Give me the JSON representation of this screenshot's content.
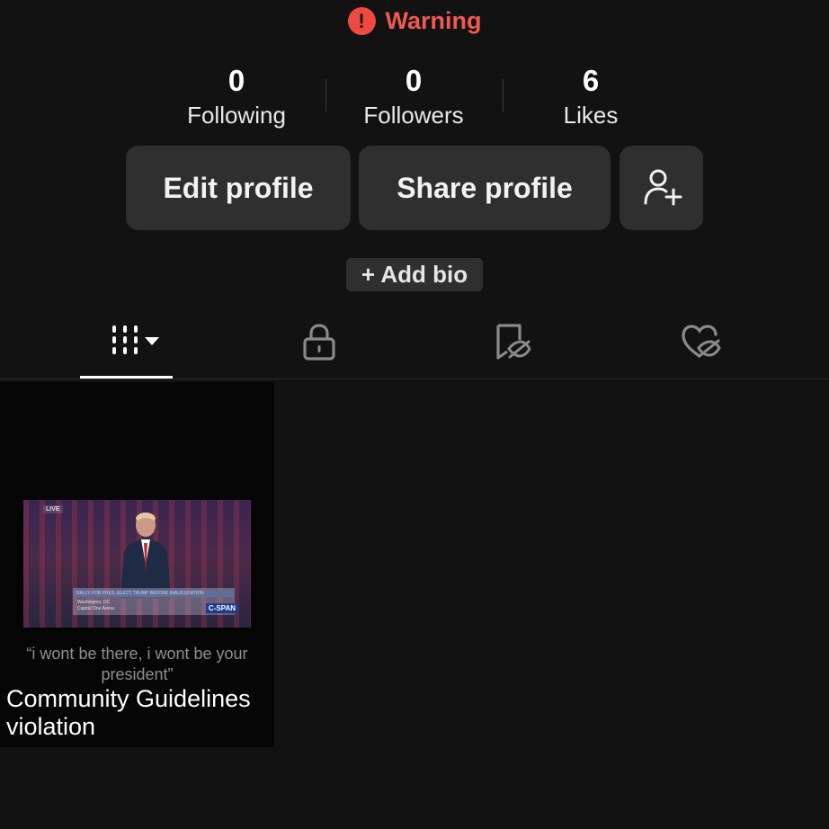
{
  "warning": {
    "icon": "exclamation-circle-icon",
    "label": "Warning",
    "color": "#ee4a43"
  },
  "stats": [
    {
      "value": "0",
      "label": "Following"
    },
    {
      "value": "0",
      "label": "Followers"
    },
    {
      "value": "6",
      "label": "Likes"
    }
  ],
  "actions": {
    "edit_label": "Edit profile",
    "share_label": "Share profile",
    "add_friend_icon": "add-person-icon"
  },
  "bio": {
    "add_label": "+ Add bio"
  },
  "tabs": [
    {
      "icon": "grid-videos-icon",
      "active": true
    },
    {
      "icon": "lock-icon",
      "active": false
    },
    {
      "icon": "bookmark-hidden-icon",
      "active": false
    },
    {
      "icon": "liked-hidden-icon",
      "active": false
    }
  ],
  "videos": [
    {
      "thumbnail": {
        "live_tag": "LIVE",
        "banner": "RALLY FOR PRES.-ELECT TRUMP BEFORE INAUGURATION",
        "location": "Washington, DC",
        "venue": "Capital One Arena",
        "network": "C-SPAN"
      },
      "caption": "“i wont be there, i wont be your president”",
      "status": "Community Guidelines violation"
    }
  ]
}
